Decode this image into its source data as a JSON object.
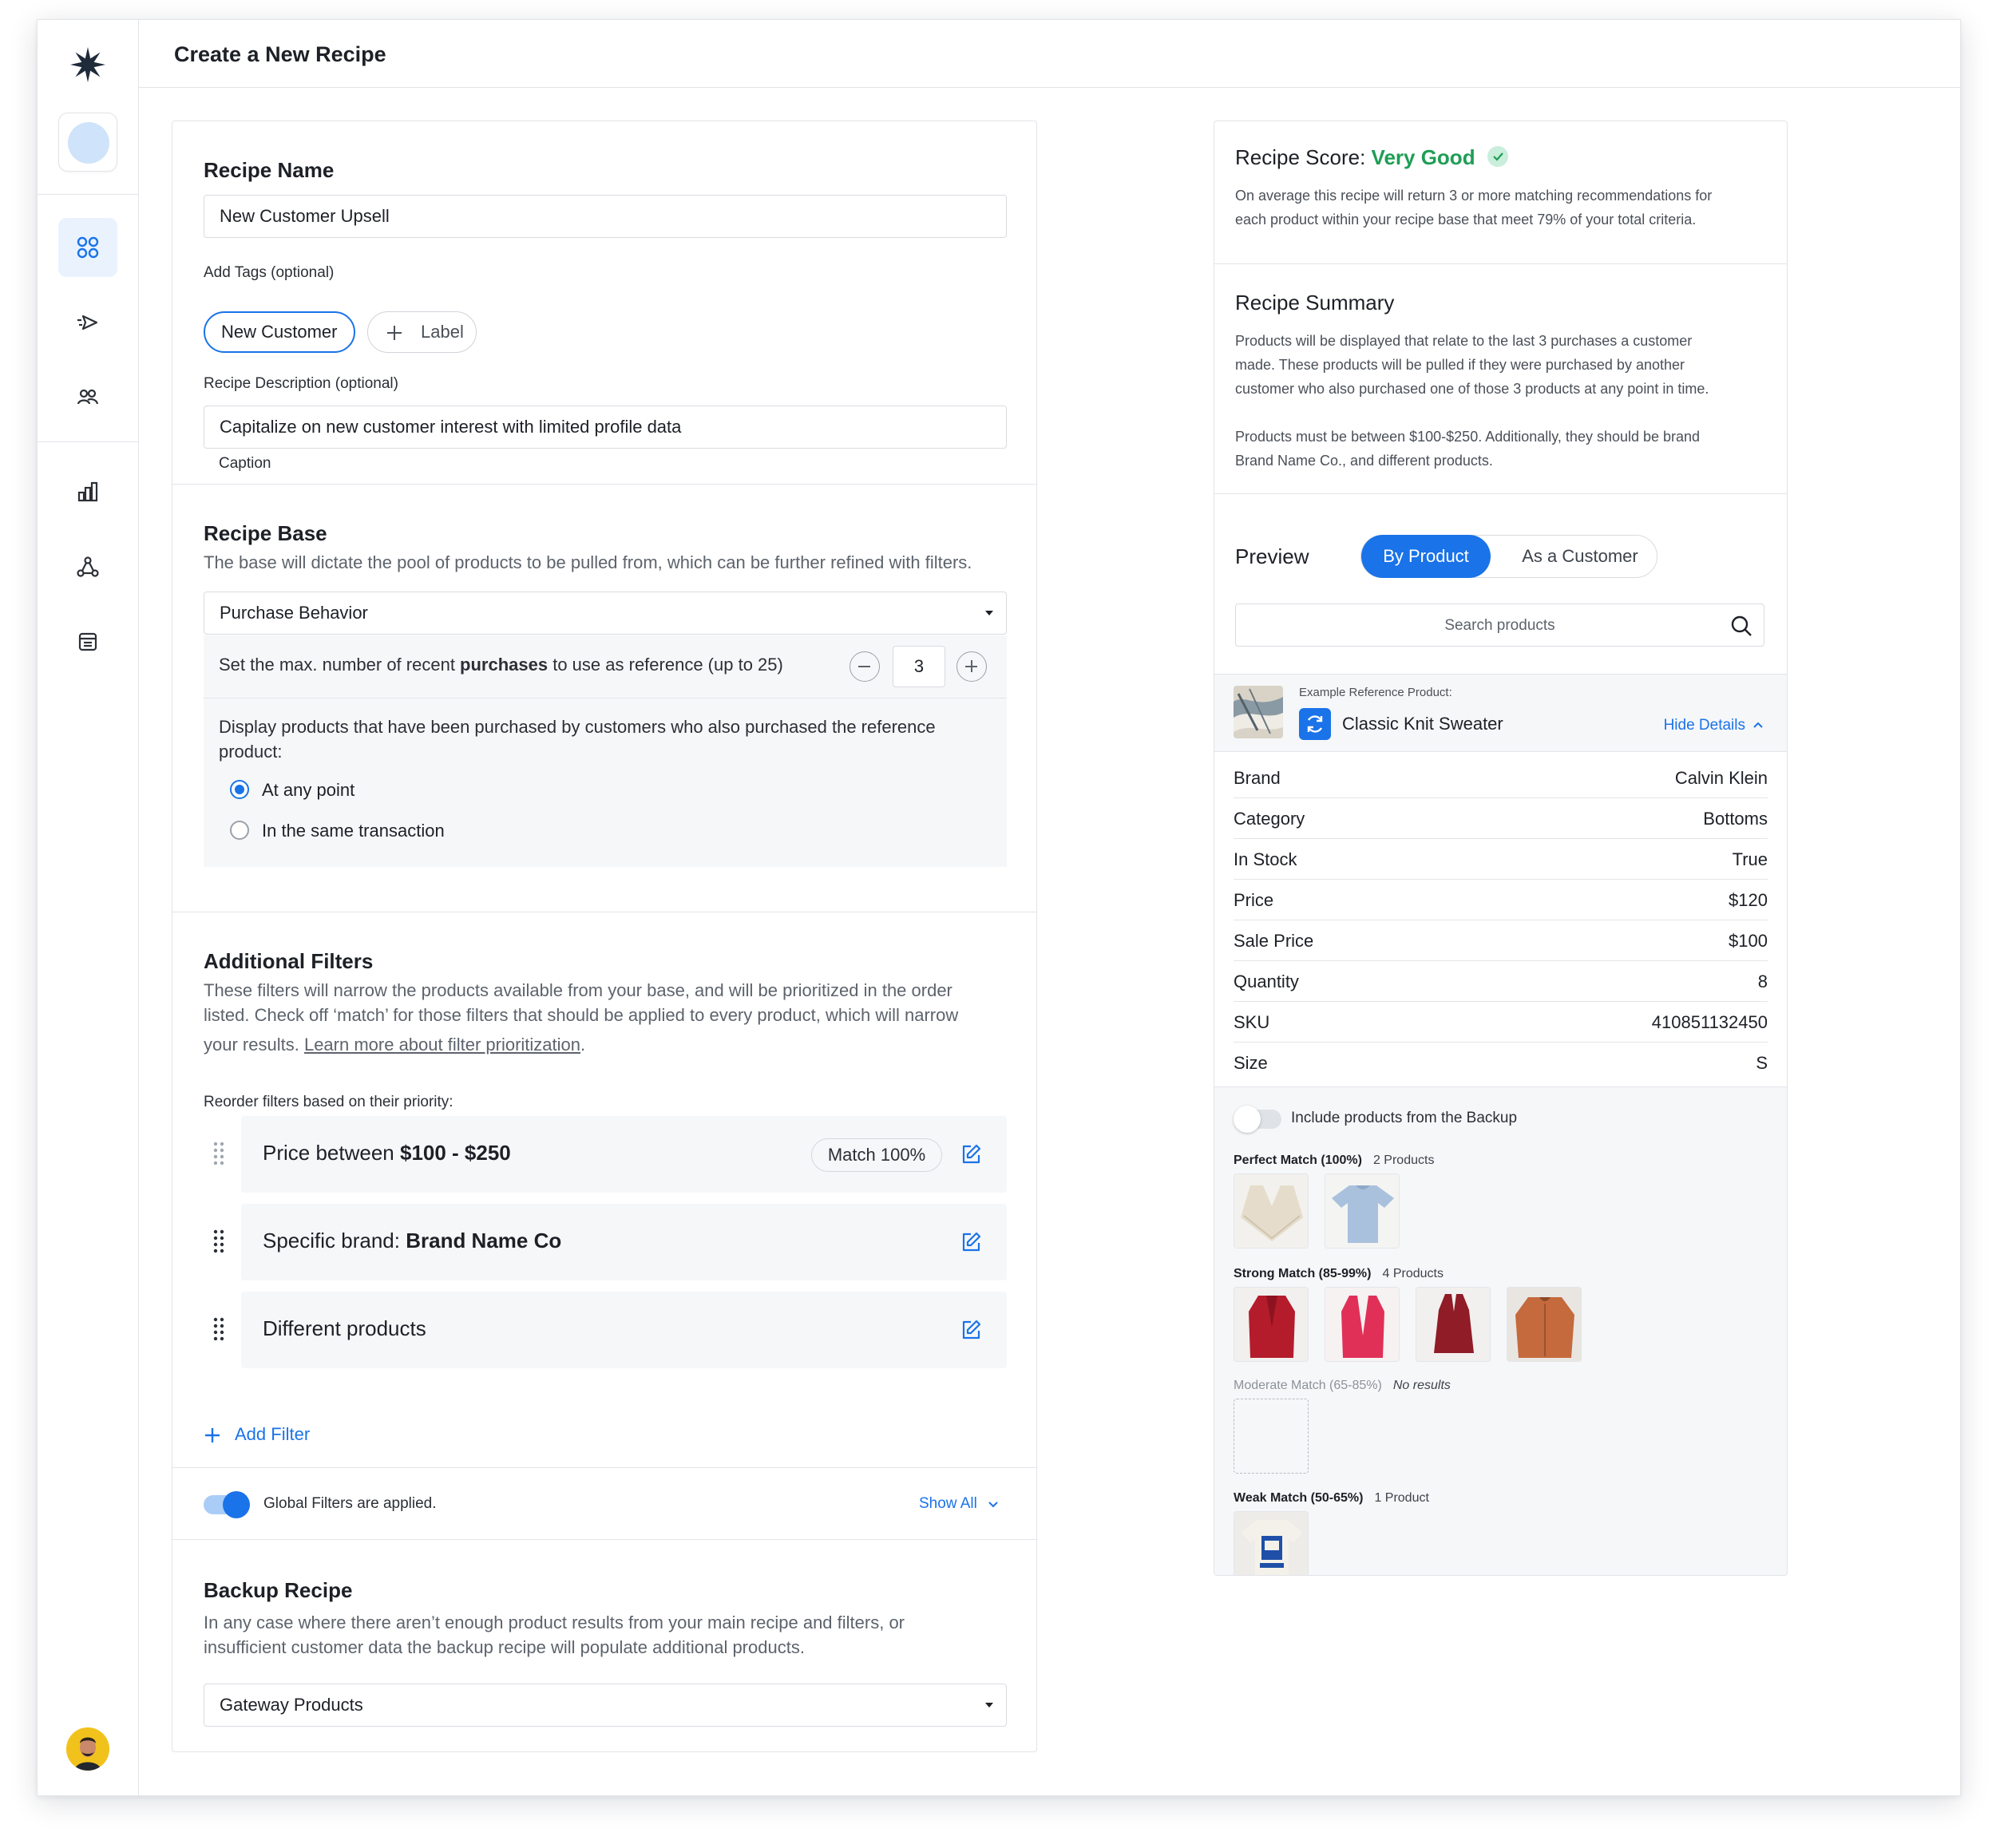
{
  "header": {
    "title": "Create a New Recipe"
  },
  "sidebar": {
    "items": [
      {
        "name": "dashboard",
        "icon": "grid-icon",
        "active": true
      },
      {
        "name": "campaigns",
        "icon": "send-icon",
        "active": false
      },
      {
        "name": "audiences",
        "icon": "users-icon",
        "active": false
      },
      {
        "name": "analytics",
        "icon": "bar-chart-icon",
        "active": false
      },
      {
        "name": "integrations",
        "icon": "nodes-icon",
        "active": false
      },
      {
        "name": "catalog",
        "icon": "archive-icon",
        "active": false
      }
    ]
  },
  "recipe_name": {
    "heading": "Recipe Name",
    "value": "New Customer Upsell",
    "tags_label": "Add Tags (optional)",
    "tags": [
      "New Customer"
    ],
    "add_label": "Label",
    "desc_label": "Recipe Description (optional)",
    "desc_value": "Capitalize on new customer interest with limited profile data",
    "caption": "Caption"
  },
  "recipe_base": {
    "heading": "Recipe Base",
    "description": "The base will dictate the pool of products to be pulled from, which can be further refined with filters.",
    "selected": "Purchase Behavior",
    "max_text_pre": "Set the max. number of recent ",
    "max_text_bold": "purchases",
    "max_text_post": " to use as reference (up to 25)",
    "max_value": "3",
    "display_text": "Display products that have been purchased by customers who also purchased the reference product:",
    "options": [
      {
        "label": "At any point",
        "checked": true
      },
      {
        "label": "In the same transaction",
        "checked": false
      }
    ]
  },
  "filters": {
    "heading": "Additional Filters",
    "description_1": "These filters will narrow the products available from your base, and will be prioritized in the order",
    "description_2": "listed. Check off ‘match’ for those filters that should be applied to every product, which will narrow",
    "description_3": "your results.",
    "learn_more": "Learn more about filter prioritization",
    "reorder_label": "Reorder filters based on their priority:",
    "items": [
      {
        "pre": "Price between ",
        "bold": "$100 - $250",
        "match": "Match 100%"
      },
      {
        "pre": "Specific brand: ",
        "bold": "Brand Name Co",
        "match": ""
      },
      {
        "pre": "Different products",
        "bold": "",
        "match": ""
      }
    ],
    "add_label": "Add Filter",
    "global_label": "Global Filters are applied.",
    "global_on": true,
    "show_all": "Show All"
  },
  "backup": {
    "heading": "Backup Recipe",
    "description_1": "In any case where there aren’t enough product results from your main recipe and filters, or",
    "description_2": "insufficient customer data the backup recipe will populate additional products.",
    "selected": "Gateway Products"
  },
  "score": {
    "prefix": "Recipe Score: ",
    "value": "Very Good",
    "value_color": "#1e9e55",
    "description_1": "On average this recipe will return 3 or more matching recommendations for",
    "description_2": "each product within your recipe base that meet 79% of your total criteria."
  },
  "summary": {
    "heading": "Recipe Summary",
    "p1_1": "Products will be displayed that relate to the last 3 purchases a customer",
    "p1_2": "made. These products will be pulled if they were purchased by another",
    "p1_3": "customer who also purchased one of those 3 products at any point in time.",
    "p2_1": "Products must be between $100-$250. Additionally, they should be brand",
    "p2_2": "Brand Name Co., and different products."
  },
  "preview": {
    "heading": "Preview",
    "tabs": [
      "By Product",
      "As a Customer"
    ],
    "active_tab": 0,
    "search_placeholder": "Search products",
    "ref_label": "Example Reference Product:",
    "ref_name": "Classic Knit Sweater",
    "hide_details": "Hide Details",
    "attributes": [
      {
        "k": "Brand",
        "v": "Calvin Klein"
      },
      {
        "k": "Category",
        "v": "Bottoms"
      },
      {
        "k": "In Stock",
        "v": "True"
      },
      {
        "k": "Price",
        "v": "$120"
      },
      {
        "k": "Sale Price",
        "v": "$100"
      },
      {
        "k": "Quantity",
        "v": "8"
      },
      {
        "k": "SKU",
        "v": "410851132450"
      },
      {
        "k": "Size",
        "v": "S"
      }
    ],
    "include_backup": "Include products from the Backup",
    "include_backup_on": false,
    "groups": [
      {
        "label": "Perfect Match (100%)",
        "count": "2 Products"
      },
      {
        "label": "Strong Match (85-99%)",
        "count": "4 Products"
      },
      {
        "label": "Moderate Match (65-85%)",
        "count": "No results"
      },
      {
        "label": "Weak Match (50-65%)",
        "count": "1 Product"
      }
    ]
  },
  "colors": {
    "accent": "#1a73e8",
    "good": "#1e9e55",
    "border": "#e1e4e8"
  }
}
